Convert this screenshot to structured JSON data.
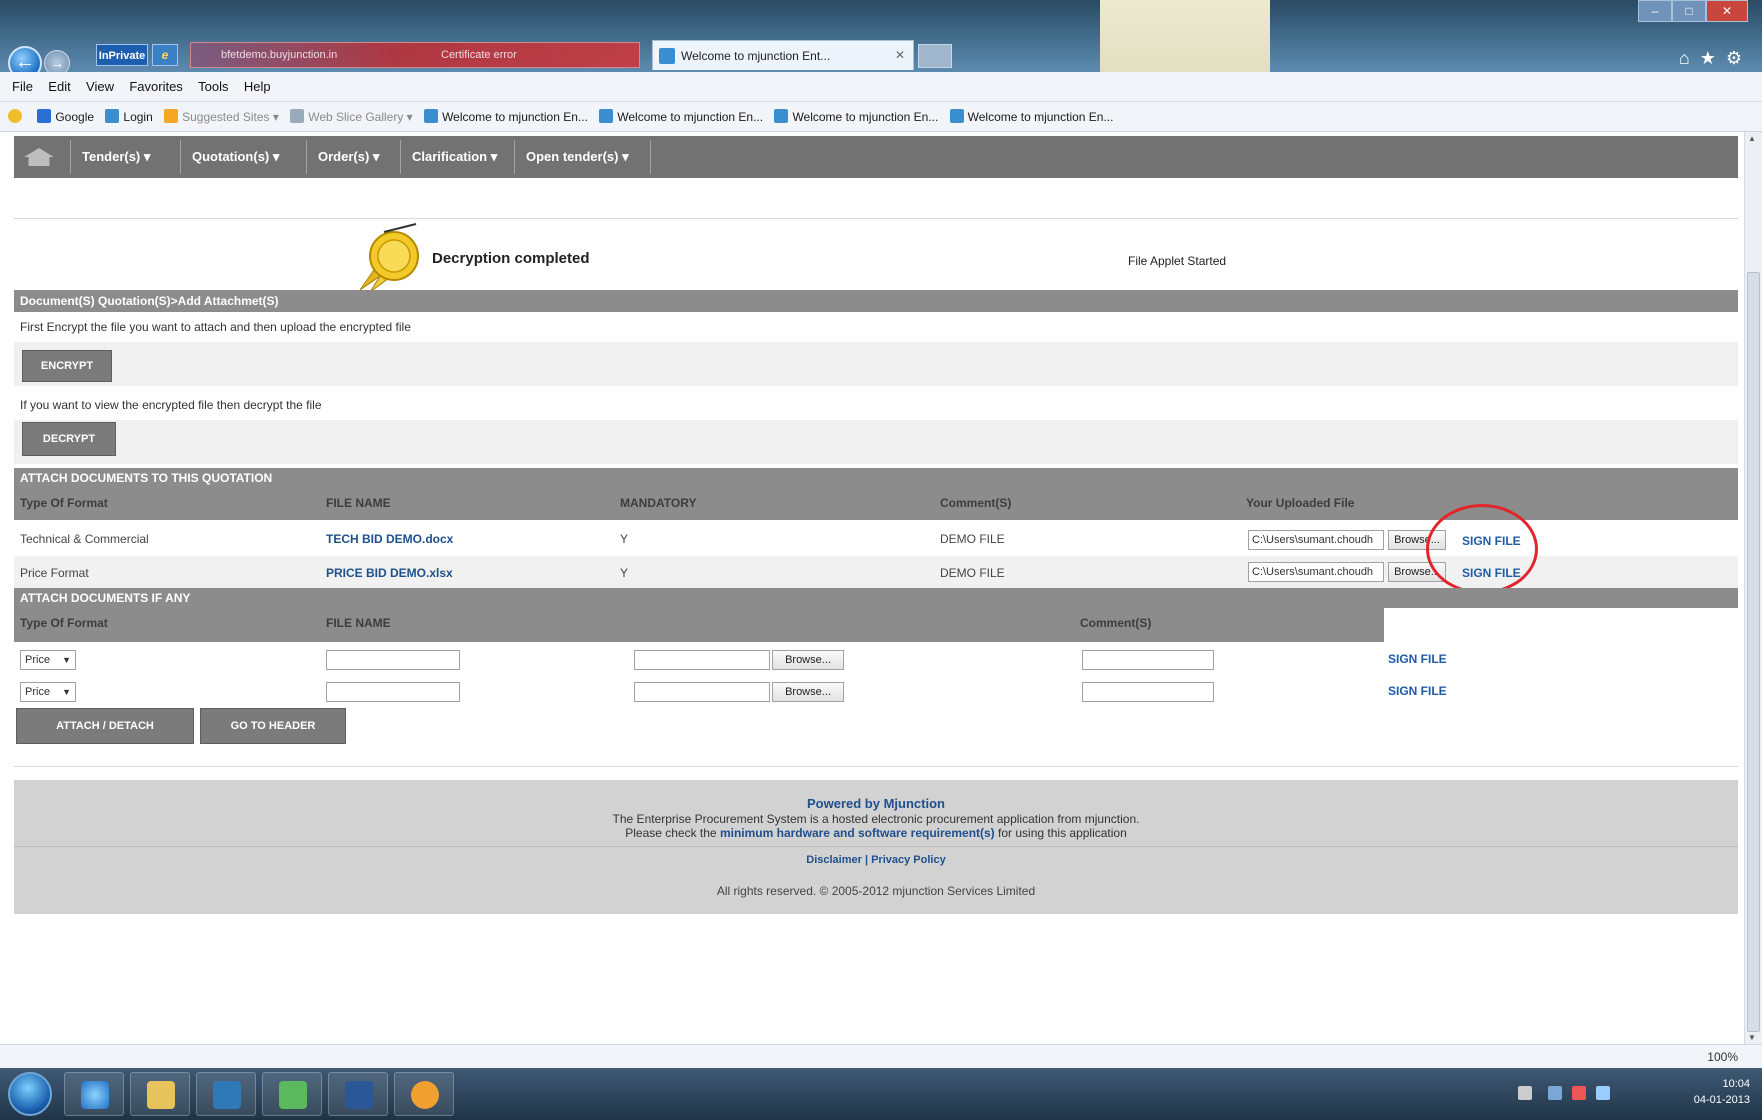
{
  "browser": {
    "inprivate_label": "InPrivate",
    "blurred_tab_1": "bfetdemo.buyjunction.in",
    "blurred_tab_2": "Certificate error",
    "active_tab": "Welcome to mjunction Ent...",
    "menu": [
      "File",
      "Edit",
      "View",
      "Favorites",
      "Tools",
      "Help"
    ],
    "favorites": [
      "Google",
      "Login",
      "Suggested Sites ▾",
      "Web Slice Gallery ▾",
      "Welcome to mjunction En...",
      "Welcome to mjunction En...",
      "Welcome to mjunction En...",
      "Welcome to mjunction En..."
    ],
    "zoom": "100%"
  },
  "nav": {
    "items": [
      "Tender(s) ▾",
      "Quotation(s) ▾",
      "Order(s) ▾",
      "Clarification ▾",
      "Open tender(s) ▾"
    ]
  },
  "status": {
    "seal_text": "Decryption completed",
    "applet_text": "File Applet Started"
  },
  "section1": {
    "title": "Document(S) Quotation(S)>Add Attachmet(S)",
    "encrypt_hint": "First Encrypt the file you want to attach and then upload the encrypted file",
    "encrypt_button": "ENCRYPT",
    "decrypt_hint": "If you want to view the encrypted file then decrypt the file",
    "decrypt_button": "DECRYPT"
  },
  "attach_quotation": {
    "title": "ATTACH DOCUMENTS TO THIS QUOTATION",
    "headers": [
      "Type Of Format",
      "FILE NAME",
      "MANDATORY",
      "Comment(S)",
      "Your Uploaded File"
    ],
    "rows": [
      {
        "type": "Technical & Commercial",
        "file": "TECH BID DEMO.docx",
        "mandatory": "Y",
        "comment": "DEMO FILE",
        "path": "C:\\Users\\sumant.choudh",
        "browse": "Browse...",
        "sign": "SIGN FILE"
      },
      {
        "type": "Price Format",
        "file": "PRICE BID DEMO.xlsx",
        "mandatory": "Y",
        "comment": "DEMO FILE",
        "path": "C:\\Users\\sumant.choudh",
        "browse": "Browse...",
        "sign": "SIGN FILE"
      }
    ]
  },
  "attach_any": {
    "title": "ATTACH DOCUMENTS IF ANY",
    "headers": [
      "Type Of Format",
      "FILE NAME",
      "Comment(S)"
    ],
    "rows": [
      {
        "select": "Price",
        "browse": "Browse...",
        "sign": "SIGN FILE"
      },
      {
        "select": "Price",
        "browse": "Browse...",
        "sign": "SIGN FILE"
      }
    ],
    "attach_button": "ATTACH / DETACH",
    "header_button": "GO TO HEADER"
  },
  "footer": {
    "powered": "Powered by Mjunction",
    "line1": "The Enterprise Procurement System is a hosted electronic procurement application from mjunction.",
    "line2_pre": "Please check the",
    "line2_link": "minimum hardware and software requirement(s)",
    "line2_post": "for using this application",
    "links": "Disclaimer | Privacy Policy",
    "copyright": "All rights reserved. © 2005-2012 mjunction Services Limited"
  },
  "taskbar": {
    "time": "10:04",
    "date": "04-01-2013"
  },
  "colors": {
    "nav_bg": "#727272",
    "section_bg": "#8c8c8c",
    "link": "#1f5ca8",
    "highlight_ring": "#e2252b"
  }
}
